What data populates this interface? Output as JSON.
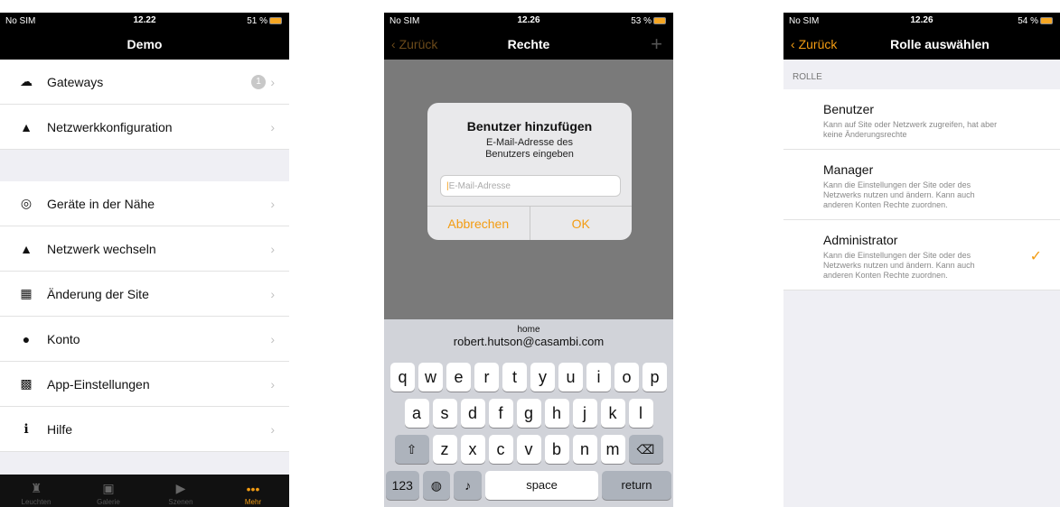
{
  "phone1": {
    "status": {
      "carrier": "No SIM",
      "time": "12.22",
      "battery": "51 %"
    },
    "title": "Demo",
    "menu_group1": [
      {
        "label": "Gateways",
        "icon": "cloud-upload-icon",
        "badge": "1"
      },
      {
        "label": "Netzwerkkonfiguration",
        "icon": "network-icon"
      }
    ],
    "menu_group2": [
      {
        "label": "Geräte in der Nähe",
        "icon": "nearby-icon"
      },
      {
        "label": "Netzwerk wechseln",
        "icon": "network-icon"
      },
      {
        "label": "Änderung der Site",
        "icon": "building-icon"
      },
      {
        "label": "Konto",
        "icon": "user-icon"
      },
      {
        "label": "App-Einstellungen",
        "icon": "settings-grid-icon"
      },
      {
        "label": "Hilfe",
        "icon": "info-icon"
      }
    ],
    "tabs": [
      {
        "label": "Leuchten",
        "icon": "lamp-icon"
      },
      {
        "label": "Galerie",
        "icon": "gallery-icon"
      },
      {
        "label": "Szenen",
        "icon": "scene-icon"
      },
      {
        "label": "Mehr",
        "icon": "more-icon",
        "active": true
      }
    ]
  },
  "phone2": {
    "status": {
      "carrier": "No SIM",
      "time": "12.26",
      "battery": "53 %"
    },
    "title": "Rechte",
    "back": "Zurück",
    "alert": {
      "title": "Benutzer hinzufügen",
      "message": "E-Mail-Adresse des Benutzers eingeben",
      "placeholder": "E-Mail-Adresse",
      "cancel": "Abbrechen",
      "ok": "OK"
    },
    "keyboard": {
      "suggestion_label": "home",
      "suggestion": "robert.hutson@casambi.com",
      "row1": [
        "q",
        "w",
        "e",
        "r",
        "t",
        "y",
        "u",
        "i",
        "o",
        "p"
      ],
      "row2": [
        "a",
        "s",
        "d",
        "f",
        "g",
        "h",
        "j",
        "k",
        "l"
      ],
      "row3": [
        "z",
        "x",
        "c",
        "v",
        "b",
        "n",
        "m"
      ],
      "numbers": "123",
      "space": "space",
      "return": "return"
    }
  },
  "phone3": {
    "status": {
      "carrier": "No SIM",
      "time": "12.26",
      "battery": "54 %"
    },
    "title": "Rolle auswählen",
    "back": "Zurück",
    "section": "ROLLE",
    "roles": [
      {
        "name": "Benutzer",
        "desc": "Kann auf Site oder Netzwerk zugreifen, hat aber keine Änderungsrechte"
      },
      {
        "name": "Manager",
        "desc": "Kann die Einstellungen der Site oder des Netzwerks nutzen und ändern. Kann auch anderen Konten Rechte zuordnen."
      },
      {
        "name": "Administrator",
        "desc": "Kann die Einstellungen der Site oder des Netzwerks nutzen und ändern. Kann auch anderen Konten Rechte zuordnen.",
        "selected": true
      }
    ]
  }
}
